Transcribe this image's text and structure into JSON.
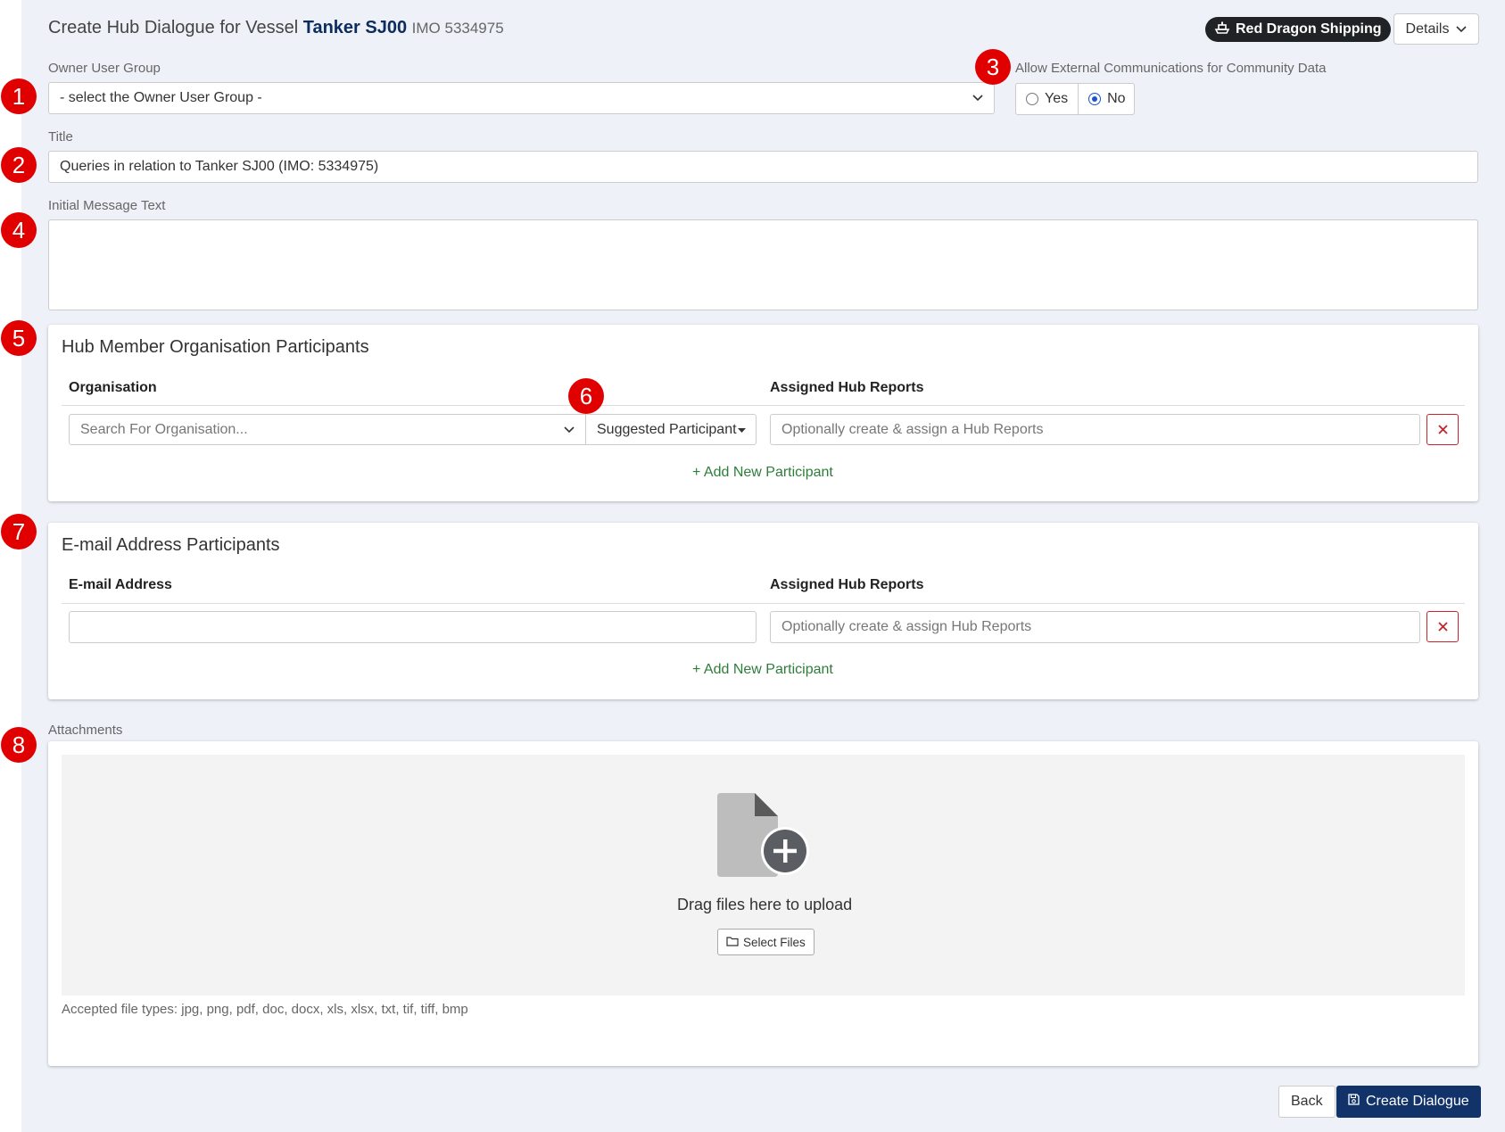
{
  "header": {
    "title_prefix": "Create Hub Dialogue for Vessel",
    "vessel_name": "Tanker SJ00",
    "imo_text": "IMO 5334975",
    "org_name": "Red Dragon Shipping",
    "details_label": "Details"
  },
  "owner_group": {
    "label": "Owner User Group",
    "value": "- select the Owner User Group -"
  },
  "external_comms": {
    "label": "Allow External Communications for Community Data",
    "options": [
      "Yes",
      "No"
    ],
    "selected": "No"
  },
  "title_field": {
    "label": "Title",
    "value": "Queries in relation to Tanker SJ00 (IMO: 5334975)"
  },
  "initial_message": {
    "label": "Initial Message Text",
    "value": ""
  },
  "hub_participants": {
    "title": "Hub Member Organisation Participants",
    "col_org": "Organisation",
    "col_reports": "Assigned Hub Reports",
    "org_placeholder": "Search For Organisation...",
    "role_value": "Suggested Participant",
    "reports_placeholder": "Optionally create & assign a Hub Reports",
    "add_label": "+ Add New Participant"
  },
  "email_participants": {
    "title": "E-mail Address Participants",
    "col_email": "E-mail Address",
    "col_reports": "Assigned Hub Reports",
    "email_value": "",
    "reports_placeholder": "Optionally create & assign Hub Reports",
    "add_label": "+ Add New Participant"
  },
  "attachments": {
    "label": "Attachments",
    "drop_text": "Drag files here to upload",
    "select_files_label": "Select Files",
    "accepted_text": "Accepted file types: jpg, png, pdf, doc, docx, xls, xlsx, txt, tif, tiff, bmp"
  },
  "footer": {
    "back_label": "Back",
    "create_label": "Create Dialogue"
  },
  "annotations": [
    "1",
    "2",
    "3",
    "4",
    "5",
    "6",
    "7",
    "8"
  ],
  "colors": {
    "accent_navy": "#11336a",
    "badge_red": "#e00000",
    "delete_red": "#c8232c",
    "add_green": "#2f7d3a",
    "radio_blue": "#1a56c8"
  },
  "icons": [
    "ship-icon",
    "chevron-down-icon",
    "caret-down-icon",
    "close-icon",
    "file-add-icon",
    "folder-icon",
    "save-icon"
  ]
}
